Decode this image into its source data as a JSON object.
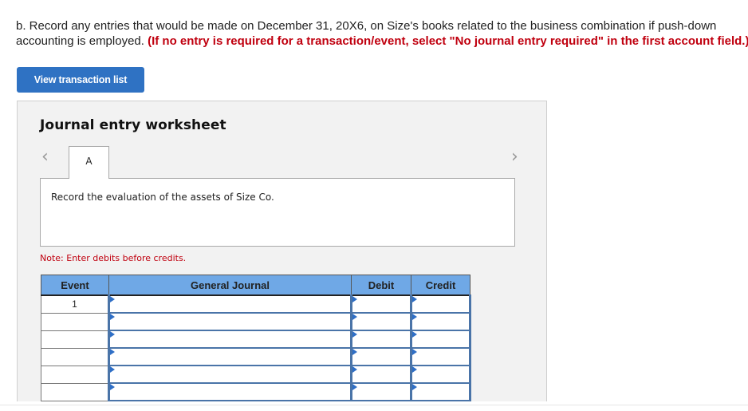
{
  "instructions": {
    "line1": "b. Record any entries that would be made on December 31, 20X6, on Size's books related to the business combination if push-down",
    "line2_plain": "accounting is employed. ",
    "line2_red": "(If no entry is required for a transaction/event, select \"No journal entry required\" in the first account field.)"
  },
  "buttons": {
    "view_transaction_list": "View transaction list"
  },
  "worksheet": {
    "title": "Journal entry worksheet",
    "prev_icon": "‹",
    "next_icon": "›",
    "tabs": [
      {
        "label": "A",
        "active": true
      }
    ],
    "description": "Record the evaluation of the assets of Size Co.",
    "note": "Note: Enter debits before credits."
  },
  "journal": {
    "headers": {
      "event": "Event",
      "account": "General Journal",
      "debit": "Debit",
      "credit": "Credit"
    },
    "rows": [
      {
        "event": "1",
        "account": "",
        "debit": "",
        "credit": ""
      },
      {
        "event": "",
        "account": "",
        "debit": "",
        "credit": ""
      },
      {
        "event": "",
        "account": "",
        "debit": "",
        "credit": ""
      },
      {
        "event": "",
        "account": "",
        "debit": "",
        "credit": ""
      },
      {
        "event": "",
        "account": "",
        "debit": "",
        "credit": ""
      },
      {
        "event": "",
        "account": "",
        "debit": "",
        "credit": ""
      }
    ]
  },
  "colors": {
    "accent_blue": "#2f72c3",
    "header_blue": "#6fa8e6",
    "warning_red": "#c0000f"
  }
}
